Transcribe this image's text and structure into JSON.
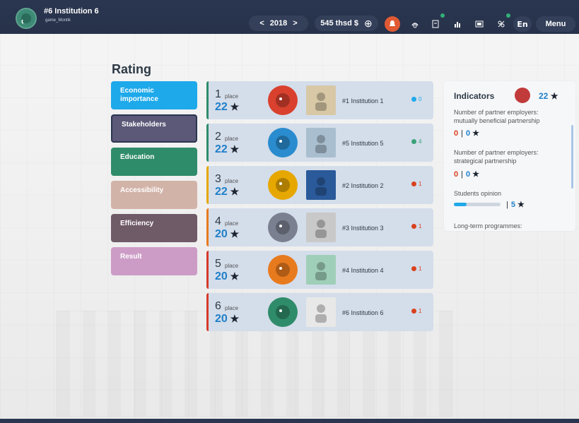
{
  "topbar": {
    "institution_title": "#6 Institution 6",
    "username": "game_Montik",
    "year": "2018",
    "year_prev": "<",
    "year_next": ">",
    "money": "545 thsd $",
    "add_symbol": "⊕",
    "lang": "En",
    "menu": "Menu",
    "icons": [
      "notification-icon",
      "hands-icon",
      "document-icon",
      "chart-icon",
      "report-icon",
      "people-icon"
    ]
  },
  "page": {
    "title": "Rating"
  },
  "categories": [
    {
      "label": "Economic importance",
      "color": "#1ea9ea"
    },
    {
      "label": "Stakeholders",
      "color": "#5c5878"
    },
    {
      "label": "Education",
      "color": "#2f8c6a"
    },
    {
      "label": "Accessibility",
      "color": "#d2b3a8"
    },
    {
      "label": "Efficiency",
      "color": "#6f5a67"
    },
    {
      "label": "Result",
      "color": "#cc9cc6"
    }
  ],
  "ranking": {
    "place_word": "place",
    "rows": [
      {
        "place": "1",
        "stars": "22",
        "institution": "#1 Institution 1",
        "trend": "0",
        "trend_color": "#1ea9ea",
        "bar_color": "#2f8c6a"
      },
      {
        "place": "2",
        "stars": "22",
        "institution": "#5 Institution 5",
        "trend": "4",
        "trend_color": "#3aa37a",
        "bar_color": "#2f8c6a"
      },
      {
        "place": "3",
        "stars": "22",
        "institution": "#2 Institution 2",
        "trend": "1",
        "trend_color": "#d9411e",
        "bar_color": "#e6a700"
      },
      {
        "place": "4",
        "stars": "20",
        "institution": "#3 Institution 3",
        "trend": "1",
        "trend_color": "#d9411e",
        "bar_color": "#e87a1e"
      },
      {
        "place": "5",
        "stars": "20",
        "institution": "#4 Institution 4",
        "trend": "1",
        "trend_color": "#d9411e",
        "bar_color": "#d43a2a"
      },
      {
        "place": "6",
        "stars": "20",
        "institution": "#6 Institution 6",
        "trend": "1",
        "trend_color": "#d9411e",
        "bar_color": "#d43a2a"
      }
    ]
  },
  "indicators": {
    "title": "Indicators",
    "score": "22",
    "items": [
      {
        "label": "Number of partner employers: mutually beneficial partnership",
        "left": "0",
        "sep": "|",
        "right": "0"
      },
      {
        "label": "Number of partner employers: strategical partnership",
        "left": "0",
        "sep": "|",
        "right": "0"
      }
    ],
    "students_opinion": {
      "label": "Students opinion",
      "progress": 0.27,
      "sep": "|",
      "value": "5"
    },
    "long_term": {
      "label": "Long-term programmes:"
    }
  }
}
